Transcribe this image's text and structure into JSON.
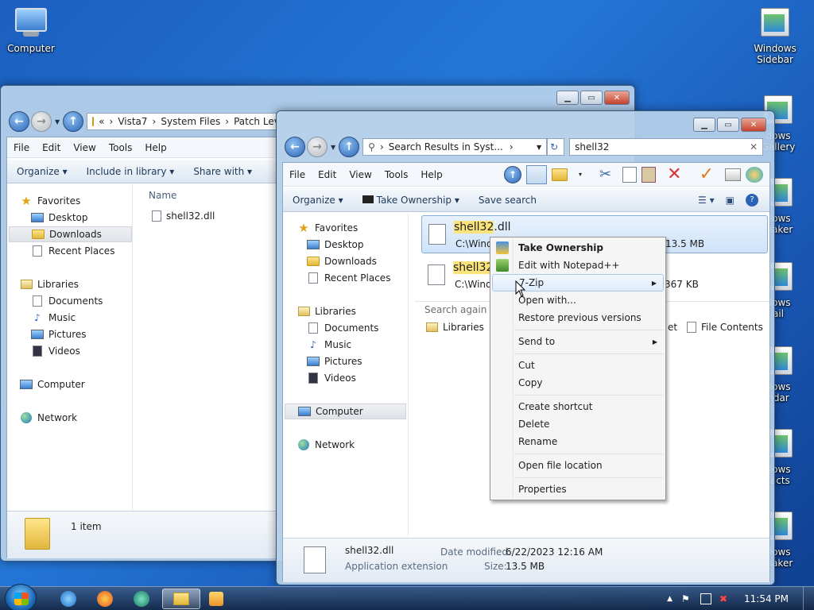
{
  "desktop": {
    "icons": [
      {
        "label": "Computer"
      },
      {
        "label_line1": "Windows",
        "label_line2": "Sidebar"
      },
      {
        "label_line1": "dows",
        "label_line2": "Gallery"
      },
      {
        "label_line1": "dows",
        "label_line2": "Maker"
      },
      {
        "label_line1": "dows",
        "label_line2": "ail"
      },
      {
        "label_line1": "dows",
        "label_line2": "ndar"
      },
      {
        "label_line1": "dows",
        "label_line2": "tacts"
      },
      {
        "label_line1": "dows",
        "label_line2": "Maker"
      }
    ]
  },
  "back_window": {
    "breadcrumb": [
      "«",
      "Vista7",
      "System Files",
      "Patch Leve"
    ],
    "menu": [
      "File",
      "Edit",
      "View",
      "Tools",
      "Help"
    ],
    "commands": [
      "Organize",
      "Include in library",
      "Share with"
    ],
    "nav": {
      "favorites": "Favorites",
      "desktop": "Desktop",
      "downloads": "Downloads",
      "recent": "Recent Places",
      "libraries": "Libraries",
      "documents": "Documents",
      "music": "Music",
      "pictures": "Pictures",
      "videos": "Videos",
      "computer": "Computer",
      "network": "Network"
    },
    "column_name": "Name",
    "file": "shell32.dll",
    "status": "1 item"
  },
  "front_window": {
    "breadcrumb": "Search Results in Syst...",
    "search_value": "shell32",
    "menu": [
      "File",
      "Edit",
      "View",
      "Tools",
      "Help"
    ],
    "commands": {
      "organize": "Organize",
      "take_ownership": "Take Ownership",
      "save_search": "Save search"
    },
    "nav": {
      "favorites": "Favorites",
      "desktop": "Desktop",
      "downloads": "Downloads",
      "recent": "Recent Places",
      "libraries": "Libraries",
      "documents": "Documents",
      "music": "Music",
      "pictures": "Pictures",
      "videos": "Videos",
      "computer": "Computer",
      "network": "Network"
    },
    "results": [
      {
        "name_hl": "shell32",
        "name_rest": ".dll",
        "path": "C:\\Wind",
        "size": "13.5 MB"
      },
      {
        "name_hl": "shell32",
        "name_rest": "",
        "path": "C:\\Wind",
        "size": "367 KB"
      }
    ],
    "search_again": "Search again in:",
    "search_libraries": "Libraries",
    "search_et": "et",
    "file_contents": "File Contents",
    "details": {
      "name": "shell32.dll",
      "type": "Application extension",
      "modified_label": "Date modified:",
      "modified": "6/22/2023 12:16 AM",
      "size_label": "Size:",
      "size": "13.5 MB"
    }
  },
  "context_menu": {
    "take_ownership": "Take Ownership",
    "edit_notepad": "Edit with Notepad++",
    "seven_zip": "7-Zip",
    "open_with": "Open with...",
    "restore": "Restore previous versions",
    "send_to": "Send to",
    "cut": "Cut",
    "copy": "Copy",
    "create_shortcut": "Create shortcut",
    "delete": "Delete",
    "rename": "Rename",
    "open_location": "Open file location",
    "properties": "Properties"
  },
  "taskbar": {
    "clock": "11:54 PM"
  }
}
